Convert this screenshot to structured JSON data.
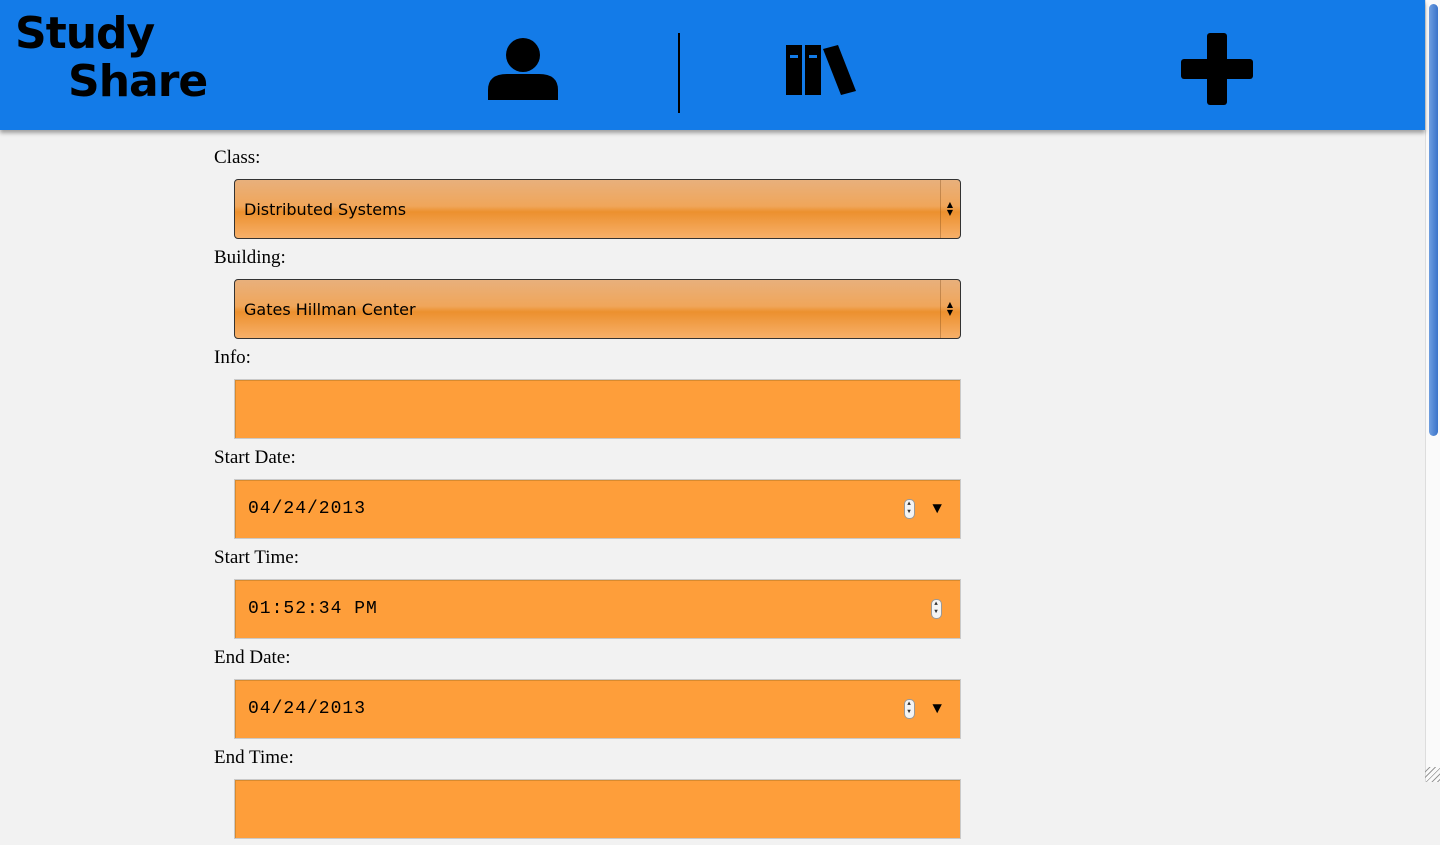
{
  "header": {
    "logo_line1": "Study",
    "logo_line2": "Share",
    "nav": [
      {
        "name": "profile",
        "icon": "user-icon"
      },
      {
        "name": "library",
        "icon": "books-icon"
      },
      {
        "name": "add",
        "icon": "plus-icon"
      }
    ],
    "accent_color": "#137be8"
  },
  "form": {
    "class_label": "Class:",
    "class_value": "Distributed Systems",
    "building_label": "Building:",
    "building_value": "Gates Hillman Center",
    "info_label": "Info:",
    "info_value": "",
    "start_date_label": "Start Date:",
    "start_date_value": "04/24/2013",
    "start_time_label": "Start Time:",
    "start_time_value": "01:52:34 PM",
    "end_date_label": "End Date:",
    "end_date_value": "04/24/2013",
    "end_time_label": "End Time:",
    "field_color": "#fe9e3a"
  }
}
